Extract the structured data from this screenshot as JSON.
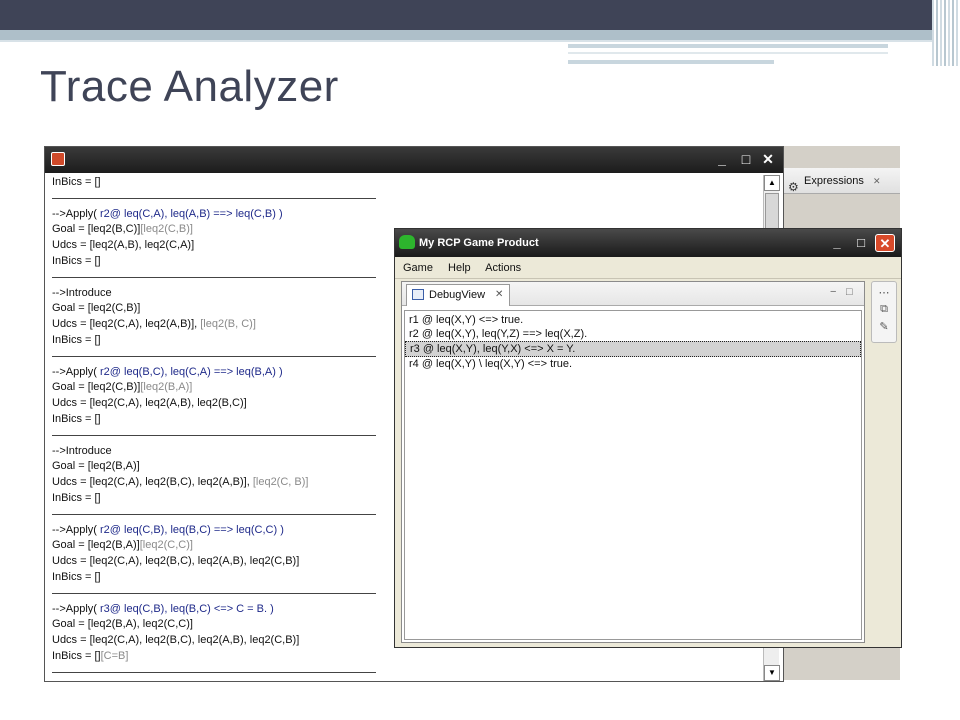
{
  "slide": {
    "title": "Trace Analyzer"
  },
  "trace_window": {
    "lines": [
      {
        "kind": "text",
        "parts": [
          {
            "t": "InBics = []",
            "c": ""
          }
        ]
      },
      {
        "kind": "sep"
      },
      {
        "kind": "text",
        "parts": [
          {
            "t": "-->Apply( ",
            "c": ""
          },
          {
            "t": "r2@ leq(C,A), leq(A,B) ==> leq(C,B) )",
            "c": "blue"
          }
        ]
      },
      {
        "kind": "text",
        "parts": [
          {
            "t": "Goal  = [leq2(B,C)]",
            "c": ""
          },
          {
            "t": "[leq2(C,B)]",
            "c": "grey"
          }
        ]
      },
      {
        "kind": "text",
        "parts": [
          {
            "t": "Udcs  = [leq2(A,B), leq2(C,A)]",
            "c": ""
          }
        ]
      },
      {
        "kind": "text",
        "parts": [
          {
            "t": "InBics = []",
            "c": ""
          }
        ]
      },
      {
        "kind": "sep"
      },
      {
        "kind": "text",
        "parts": [
          {
            "t": "-->Introduce",
            "c": ""
          }
        ]
      },
      {
        "kind": "text",
        "parts": [
          {
            "t": "Goal = [leq2(C,B)]",
            "c": ""
          }
        ]
      },
      {
        "kind": "text",
        "parts": [
          {
            "t": "Udcs  = [leq2(C,A), leq2(A,B)], ",
            "c": ""
          },
          {
            "t": "[leq2(B, C)]",
            "c": "grey"
          }
        ]
      },
      {
        "kind": "text",
        "parts": [
          {
            "t": "InBics = []",
            "c": ""
          }
        ]
      },
      {
        "kind": "sep"
      },
      {
        "kind": "text",
        "parts": [
          {
            "t": "-->Apply( ",
            "c": ""
          },
          {
            "t": "r2@ leq(B,C), leq(C,A) ==> leq(B,A) )",
            "c": "blue"
          }
        ]
      },
      {
        "kind": "text",
        "parts": [
          {
            "t": " Goal  = [leq2(C,B)]",
            "c": ""
          },
          {
            "t": "[leq2(B,A)]",
            "c": "grey"
          }
        ]
      },
      {
        "kind": "text",
        "parts": [
          {
            "t": " Udcs  = [leq2(C,A), leq2(A,B), leq2(B,C)]",
            "c": ""
          }
        ]
      },
      {
        "kind": "text",
        "parts": [
          {
            "t": " InBics = []",
            "c": ""
          }
        ]
      },
      {
        "kind": "sep"
      },
      {
        "kind": "text",
        "parts": [
          {
            "t": "-->Introduce",
            "c": ""
          }
        ]
      },
      {
        "kind": "text",
        "parts": [
          {
            "t": "Goal = [leq2(B,A)]",
            "c": ""
          }
        ]
      },
      {
        "kind": "text",
        "parts": [
          {
            "t": "Udcs  = [leq2(C,A), leq2(B,C), leq2(A,B)], ",
            "c": ""
          },
          {
            "t": "[leq2(C, B)]",
            "c": "grey"
          }
        ]
      },
      {
        "kind": "text",
        "parts": [
          {
            "t": "InBics = []",
            "c": ""
          }
        ]
      },
      {
        "kind": "sep"
      },
      {
        "kind": "text",
        "parts": [
          {
            "t": "-->Apply( ",
            "c": ""
          },
          {
            "t": "r2@ leq(C,B), leq(B,C) ==> leq(C,C) )",
            "c": "blue"
          }
        ]
      },
      {
        "kind": "text",
        "parts": [
          {
            "t": "Goal  = [leq2(B,A)]",
            "c": ""
          },
          {
            "t": "[leq2(C,C)]",
            "c": "grey"
          }
        ]
      },
      {
        "kind": "text",
        "parts": [
          {
            "t": "Udcs  = [leq2(C,A), leq2(B,C), leq2(A,B), leq2(C,B)]",
            "c": ""
          }
        ]
      },
      {
        "kind": "text",
        "parts": [
          {
            "t": "InBics = []",
            "c": ""
          }
        ]
      },
      {
        "kind": "sep"
      },
      {
        "kind": "text",
        "parts": [
          {
            "t": "-->Apply( ",
            "c": ""
          },
          {
            "t": "r3@ leq(C,B), leq(B,C) <=> C = B. )",
            "c": "blue"
          }
        ]
      },
      {
        "kind": "text",
        "parts": [
          {
            "t": "Goal  = [leq2(B,A), leq2(C,C)]",
            "c": ""
          }
        ]
      },
      {
        "kind": "text",
        "parts": [
          {
            "t": "Udcs  = [leq2(C,A), leq2(B,C), leq2(A,B), leq2(C,B)]",
            "c": ""
          }
        ]
      },
      {
        "kind": "text",
        "parts": [
          {
            "t": "InBics = []",
            "c": ""
          },
          {
            "t": "[C=B]",
            "c": "grey"
          }
        ]
      },
      {
        "kind": "sep"
      }
    ],
    "btn_minimize": "_",
    "btn_maximize": "□",
    "btn_close": "✕"
  },
  "eclipse": {
    "expressions_tab": "Expressions",
    "expressions_close": "✕"
  },
  "rcp_window": {
    "title": "My RCP Game Product",
    "btn_minimize": "_",
    "btn_maximize": "□",
    "btn_close": "✕",
    "menu": [
      "Game",
      "Help",
      "Actions"
    ],
    "view_tab": "DebugView",
    "view_tab_close": "✕",
    "view_min": "−",
    "view_max": "□",
    "rules": [
      {
        "text": "r1 @ leq(X,Y) <=> true.",
        "selected": false
      },
      {
        "text": "r2 @ leq(X,Y), leq(Y,Z) ==> leq(X,Z).",
        "selected": false
      },
      {
        "text": "r3 @ leq(X,Y), leq(Y,X) <=> X = Y.",
        "selected": true
      },
      {
        "text": "r4 @ leq(X,Y) \\ leq(X,Y) <=> true.",
        "selected": false
      }
    ]
  },
  "colors": {
    "header_dark": "#3f4457",
    "header_teal": "#aebfc9",
    "blue_rule": "#1f2a8a"
  }
}
